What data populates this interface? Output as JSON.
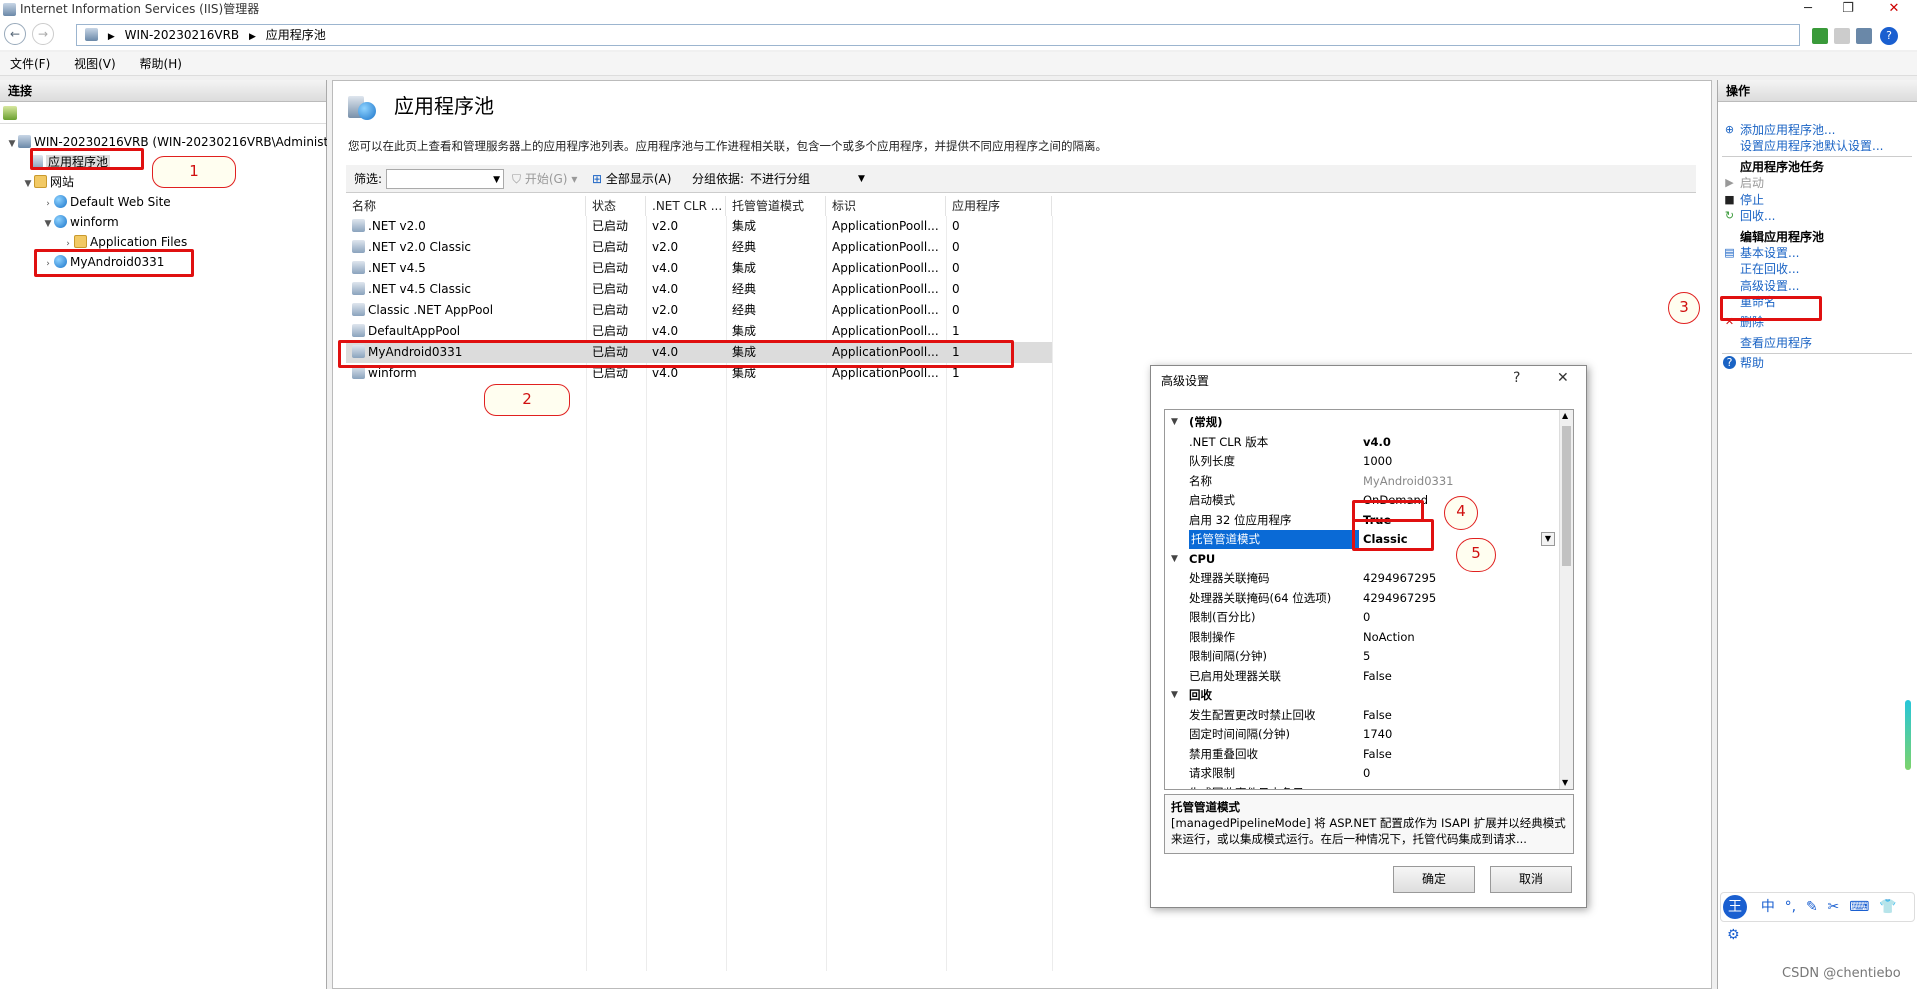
{
  "window": {
    "title": "Internet Information Services (IIS)管理器"
  },
  "nav": {
    "address_segments": [
      "WIN-20230216VRB",
      "应用程序池"
    ]
  },
  "menu": [
    "文件(F)",
    "视图(V)",
    "帮助(H)"
  ],
  "left": {
    "title": "连接",
    "tree": [
      {
        "label": "WIN-20230216VRB (WIN-20230216VRB\\Administ",
        "icon": "server-icon",
        "expanded": true
      },
      {
        "label": "应用程序池",
        "icon": "app-pool-icon",
        "selected": true
      },
      {
        "label": "网站",
        "icon": "folder-icon",
        "expanded": true
      },
      {
        "label": "Default Web Site",
        "icon": "globe-icon"
      },
      {
        "label": "winform",
        "icon": "globe-icon",
        "expanded": true
      },
      {
        "label": "Application Files",
        "icon": "folder-icon"
      },
      {
        "label": "MyAndroid0331",
        "icon": "globe-icon"
      }
    ]
  },
  "center": {
    "title": "应用程序池",
    "description": "您可以在此页上查看和管理服务器上的应用程序池列表。应用程序池与工作进程相关联，包含一个或多个应用程序，并提供不同应用程序之间的隔离。",
    "filter": {
      "label": "筛选:",
      "start": "开始(G)",
      "show_all": "全部显示(A)",
      "group_label": "分组依据:",
      "group_value": "不进行分组"
    },
    "columns": [
      "名称",
      "状态",
      ".NET CLR ...",
      "托管管道模式",
      "标识",
      "应用程序"
    ],
    "rows": [
      [
        ".NET v2.0",
        "已启动",
        "v2.0",
        "集成",
        "ApplicationPooll...",
        "0"
      ],
      [
        ".NET v2.0 Classic",
        "已启动",
        "v2.0",
        "经典",
        "ApplicationPooll...",
        "0"
      ],
      [
        ".NET v4.5",
        "已启动",
        "v4.0",
        "集成",
        "ApplicationPooll...",
        "0"
      ],
      [
        ".NET v4.5 Classic",
        "已启动",
        "v4.0",
        "经典",
        "ApplicationPooll...",
        "0"
      ],
      [
        "Classic .NET AppPool",
        "已启动",
        "v2.0",
        "经典",
        "ApplicationPooll...",
        "0"
      ],
      [
        "DefaultAppPool",
        "已启动",
        "v4.0",
        "集成",
        "ApplicationPooll...",
        "1"
      ],
      [
        "MyAndroid0331",
        "已启动",
        "v4.0",
        "集成",
        "ApplicationPooll...",
        "1"
      ],
      [
        "winform",
        "已启动",
        "v4.0",
        "集成",
        "ApplicationPooll...",
        "1"
      ]
    ],
    "selected_row": 6
  },
  "actions": {
    "title": "操作",
    "items": [
      {
        "label": "添加应用程序池...",
        "type": "link",
        "icon": "add-pool-icon"
      },
      {
        "label": "设置应用程序池默认设置...",
        "type": "link"
      },
      {
        "label": "应用程序池任务",
        "type": "header"
      },
      {
        "label": "启动",
        "type": "disabled",
        "icon": "play-icon"
      },
      {
        "label": "停止",
        "type": "link",
        "icon": "stop-icon"
      },
      {
        "label": "回收...",
        "type": "link",
        "icon": "recycle-icon"
      },
      {
        "label": "编辑应用程序池",
        "type": "header"
      },
      {
        "label": "基本设置...",
        "type": "link",
        "icon": "settings-icon"
      },
      {
        "label": "正在回收...",
        "type": "link"
      },
      {
        "label": "高级设置...",
        "type": "link"
      },
      {
        "label": "重命名",
        "type": "link"
      },
      {
        "label": "删除",
        "type": "link",
        "icon": "delete-icon"
      },
      {
        "label": "查看应用程序",
        "type": "link"
      },
      {
        "label": "帮助",
        "type": "link",
        "icon": "help-icon"
      }
    ]
  },
  "dialog": {
    "title": "高级设置",
    "help": "?",
    "close": "✕",
    "properties": [
      {
        "cat": "(常规)"
      },
      {
        "name": ".NET CLR 版本",
        "value": "v4.0",
        "bold": true
      },
      {
        "name": "队列长度",
        "value": "1000"
      },
      {
        "name": "名称",
        "value": "MyAndroid0331",
        "grey": true
      },
      {
        "name": "启动模式",
        "value": "OnDemand"
      },
      {
        "name": "启用 32 位应用程序",
        "value": "True",
        "bold": true
      },
      {
        "name": "托管管道模式",
        "value": "Classic",
        "bold": true,
        "selected": true
      },
      {
        "cat": "CPU"
      },
      {
        "name": "处理器关联掩码",
        "value": "4294967295"
      },
      {
        "name": "处理器关联掩码(64 位选项)",
        "value": "4294967295"
      },
      {
        "name": "限制(百分比)",
        "value": "0"
      },
      {
        "name": "限制操作",
        "value": "NoAction"
      },
      {
        "name": "限制间隔(分钟)",
        "value": "5"
      },
      {
        "name": "已启用处理器关联",
        "value": "False"
      },
      {
        "cat": "回收"
      },
      {
        "name": "发生配置更改时禁止回收",
        "value": "False"
      },
      {
        "name": "固定时间间隔(分钟)",
        "value": "1740"
      },
      {
        "name": "禁用重叠回收",
        "value": "False"
      },
      {
        "name": "请求限制",
        "value": "0"
      },
      {
        "name": "生成回收事件日志条目",
        "value": "",
        "collapsed": true
      }
    ],
    "desc_title": "托管管道模式",
    "desc_text": "[managedPipelineMode] 将 ASP.NET 配置成作为 ISAPI 扩展并以经典模式来运行，或以集成模式运行。在后一种情况下，托管代码集成到请求...",
    "ok": "确定",
    "cancel": "取消"
  },
  "annotations": [
    "1",
    "2",
    "3",
    "4",
    "5"
  ],
  "ime": {
    "chars": [
      "中",
      "°,",
      "✎",
      "✂",
      "⌨",
      "👕",
      "⚙"
    ]
  },
  "watermark": "CSDN @chentiebo",
  "colors": {
    "link": "#1a63c4",
    "highlight": "#0a6ad6",
    "annotation": "#e01010"
  }
}
